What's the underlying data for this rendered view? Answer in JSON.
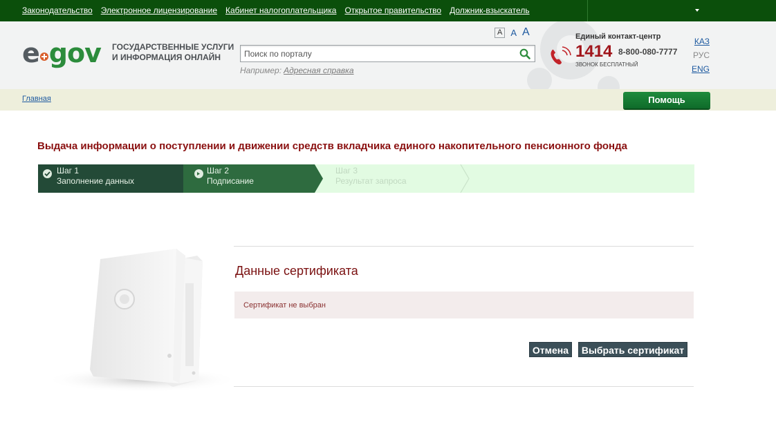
{
  "topbar": {
    "links": [
      "Законодательство",
      "Электронное лицензирование",
      "Кабинет налогоплательщика",
      "Открытое правительство",
      "Должник-взыскатель"
    ]
  },
  "header": {
    "logo_e": "e",
    "logo_gov": "gov",
    "tagline_line1": "ГОСУДАРСТВЕННЫЕ УСЛУГИ",
    "tagline_line2": "И ИНФОРМАЦИЯ ОНЛАЙН",
    "search_placeholder": "Поиск по порталу",
    "example_prefix": "Например:",
    "example_link": "Адресная справка",
    "font_sizes": [
      "A",
      "A",
      "A"
    ],
    "contact_title": "Единый контакт-центр",
    "contact_number": "1414",
    "contact_phone": "8-800-080-7777",
    "contact_free": "ЗВОНОК БЕСПЛАТНЫЙ",
    "languages": [
      "КАЗ",
      "РУС",
      "ENG"
    ],
    "active_language": "РУС"
  },
  "breadcrumb": {
    "home": "Главная"
  },
  "help_button": "Помощь",
  "page_title": "Выдача информации о поступлении и движении средств вкладчика единого накопительного пенсионного фонда",
  "steps": [
    {
      "num": "Шаг 1",
      "label": "Заполнение данных",
      "state": "done"
    },
    {
      "num": "Шаг 2",
      "label": "Подписание",
      "state": "current"
    },
    {
      "num": "Шаг 3",
      "label": "Результат запроса",
      "state": "pending"
    }
  ],
  "certificate": {
    "title": "Данные сертификата",
    "status": "Сертификат не выбран",
    "cancel_button": "Отмена",
    "select_button": "Выбрать сертификат"
  },
  "colors": {
    "topbar": "#0b4f0b",
    "step_done": "#234a37",
    "step_current": "#2e6b3f",
    "steps_bg": "#e2fbe2",
    "title_red": "#8a1010",
    "button_dark": "#3b4f58"
  },
  "icons": [
    "search-icon",
    "phone-icon",
    "check-icon",
    "arrow-icon",
    "binder-image"
  ]
}
